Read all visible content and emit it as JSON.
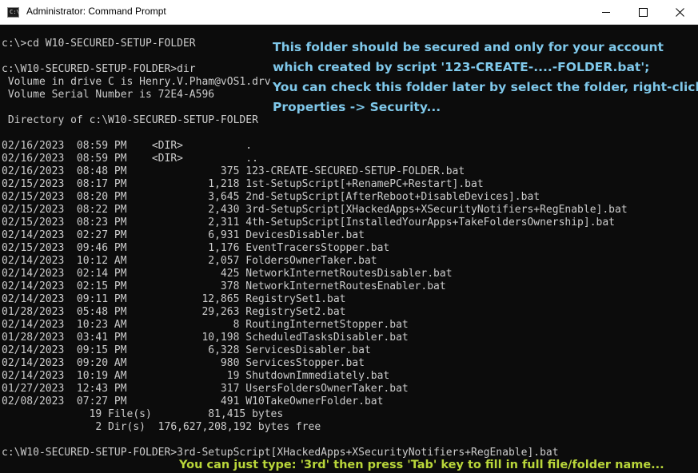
{
  "window": {
    "title": "Administrator: Command Prompt",
    "icon_label": "C:\\",
    "controls": [
      "minimize-icon",
      "maximize-icon",
      "close-icon"
    ]
  },
  "console": {
    "lines": [
      "c:\\>cd W10-SECURED-SETUP-FOLDER",
      "",
      "c:\\W10-SECURED-SETUP-FOLDER>dir",
      " Volume in drive C is Henry.V.Pham@vOS1.drv",
      " Volume Serial Number is 72E4-A596",
      "",
      " Directory of c:\\W10-SECURED-SETUP-FOLDER",
      "",
      "02/16/2023  08:59 PM    <DIR>          .",
      "02/16/2023  08:59 PM    <DIR>          ..",
      "02/16/2023  08:48 PM               375 123-CREATE-SECURED-SETUP-FOLDER.bat",
      "02/15/2023  08:17 PM             1,218 1st-SetupScript[+RenamePC+Restart].bat",
      "02/15/2023  08:20 PM             3,645 2nd-SetupScript[AfterReboot+DisableDevices].bat",
      "02/15/2023  08:22 PM             2,430 3rd-SetupScript[XHackedApps+XSecurityNotifiers+RegEnable].bat",
      "02/15/2023  08:23 PM             2,311 4th-SetupScript[InstalledYourApps+TakeFoldersOwnership].bat",
      "02/14/2023  02:27 PM             6,931 DevicesDisabler.bat",
      "02/15/2023  09:46 PM             1,176 EventTracersStopper.bat",
      "02/14/2023  10:12 AM             2,057 FoldersOwnerTaker.bat",
      "02/14/2023  02:14 PM               425 NetworkInternetRoutesDisabler.bat",
      "02/14/2023  02:15 PM               378 NetworkInternetRoutesEnabler.bat",
      "02/14/2023  09:11 PM            12,865 RegistrySet1.bat",
      "01/28/2023  05:48 PM            29,263 RegistrySet2.bat",
      "02/14/2023  10:23 AM                 8 RoutingInternetStopper.bat",
      "01/28/2023  03:41 PM            10,198 ScheduledTasksDisabler.bat",
      "02/14/2023  09:15 PM             6,328 ServicesDisabler.bat",
      "02/14/2023  09:20 AM               980 ServicesStopper.bat",
      "02/14/2023  10:19 AM                19 ShutdownImmediately.bat",
      "01/27/2023  12:43 PM               317 UsersFoldersOwnerTaker.bat",
      "02/08/2023  07:27 PM               491 W10TakeOwnerFolder.bat",
      "              19 File(s)         81,415 bytes",
      "               2 Dir(s)  176,627,208,192 bytes free",
      "",
      "c:\\W10-SECURED-SETUP-FOLDER>3rd-SetupScript[XHackedApps+XSecurityNotifiers+RegEnable].bat"
    ]
  },
  "annotations": {
    "top_note": [
      "This folder should be secured and only for your account",
      "which created by script '123-CREATE-....-FOLDER.bat';",
      "You can check this folder later by select the folder, right-click,",
      "Properties -> Security..."
    ],
    "bottom_note": "You can just type: '3rd' then press 'Tab' key to fill in full file/folder name...",
    "top_note_color": "#7fc8ea",
    "bottom_note_color": "#b9d63a"
  },
  "colors": {
    "console_bg": "#0c0c0c",
    "console_text": "#cccccc",
    "titlebar_bg": "#ffffff"
  }
}
